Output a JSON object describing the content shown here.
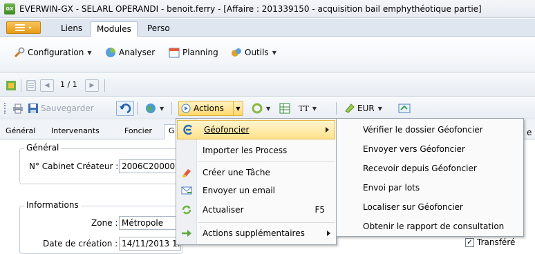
{
  "window": {
    "title": "EVERWIN-GX - SELARL OPERANDI - benoit.ferry - [Affaire : 201339150 - acquisition bail emphythéotique partie]",
    "app_icon_text": "GX"
  },
  "ribbon_tabs": [
    "Liens",
    "Modules",
    "Perso"
  ],
  "ribbon": {
    "configuration": "Configuration",
    "analyser": "Analyser",
    "planning": "Planning",
    "outils": "Outils"
  },
  "pager": {
    "text": "1 / 1"
  },
  "toolbar": {
    "save": "Sauvegarder",
    "actions": "Actions",
    "tt": "TT",
    "currency": "EUR"
  },
  "record_tabs": [
    "Général",
    "Intervenants",
    "Foncier",
    "G"
  ],
  "form": {
    "group_general": "Général",
    "cabinet_label": "N° Cabinet Créateur :",
    "cabinet_value": "2006C200009",
    "group_informations": "Informations",
    "zone_label": "Zone :",
    "zone_value": "Métropole",
    "date_label": "Date de création :",
    "date_value": "14/11/2013 1…",
    "transfere_label": "Transféré"
  },
  "actions_menu": [
    {
      "label": "Géofoncier",
      "icon": "geofoncier-icon",
      "submenu": true,
      "highlighted": true
    },
    {
      "label": "Importer les Process",
      "icon": "",
      "submenu": false
    },
    {
      "label": "Créer une Tâche",
      "icon": "task-icon",
      "submenu": false
    },
    {
      "label": "Envoyer un email",
      "icon": "email-icon",
      "submenu": false
    },
    {
      "label": "Actualiser",
      "icon": "refresh-icon",
      "shortcut": "F5",
      "submenu": false
    },
    {
      "label": "Actions supplémentaires",
      "icon": "arrow-right-icon",
      "submenu": true
    }
  ],
  "geofoncier_submenu": [
    "Vérifier le dossier Géofoncier",
    "Envoyer vers Géofoncier",
    "Recevoir depuis Géofoncier",
    "Envoi par lots",
    "Localiser sur Géofoncier",
    "Obtenir le rapport de consultation"
  ],
  "colors": {
    "highlight": "#ffe28a",
    "accent_orange": "#e79c16"
  }
}
